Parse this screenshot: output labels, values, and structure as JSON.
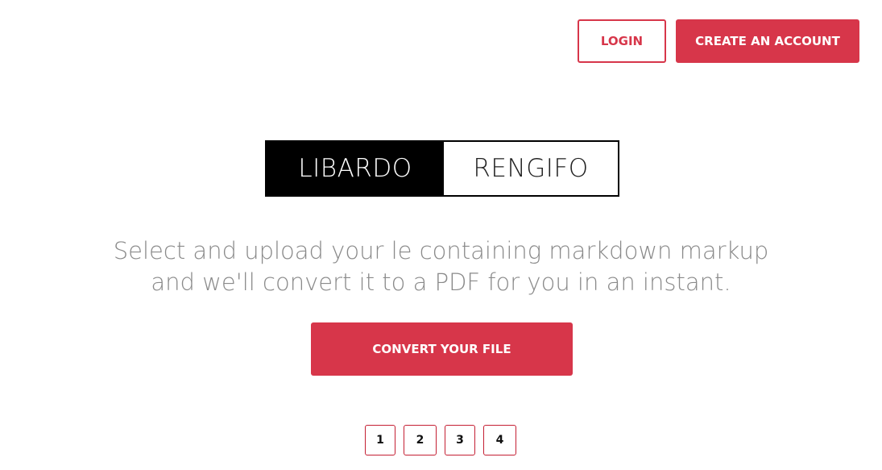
{
  "header": {
    "login_label": "LOGIN",
    "create_account_label": "CREATE AN ACCOUNT"
  },
  "logo": {
    "left_text": "LIBARDO",
    "right_text": "RENGIFO"
  },
  "tagline": {
    "line1": "Select and upload your le containing markdown markup",
    "line2": "and we'll convert it to a PDF for you in an instant."
  },
  "cta": {
    "label": "CONVERT YOUR FILE"
  },
  "pagination": {
    "pages": [
      "1",
      "2",
      "3",
      "4"
    ]
  },
  "colors": {
    "accent": "#d7364a",
    "text_muted": "#8a8a8a",
    "logo_dark": "#000000"
  }
}
